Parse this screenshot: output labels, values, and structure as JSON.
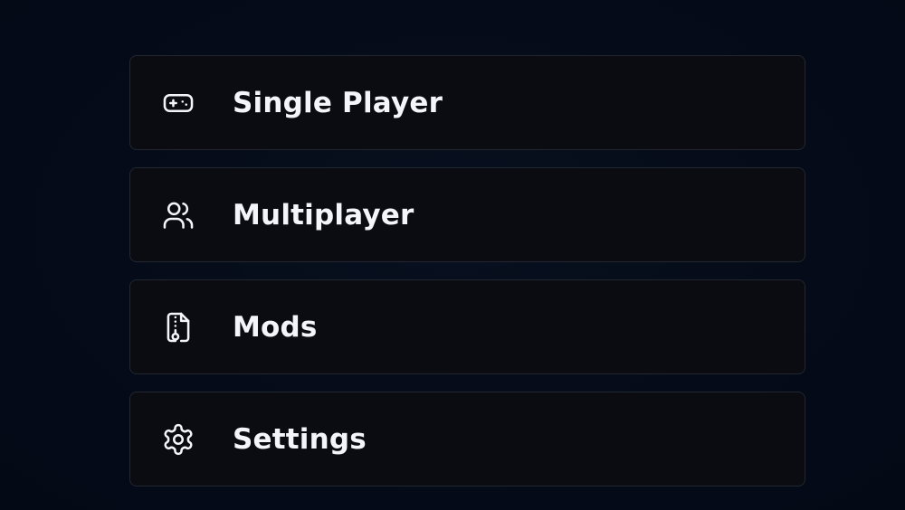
{
  "menu": {
    "items": [
      {
        "label": "Single Player",
        "icon": "gamepad-icon"
      },
      {
        "label": "Multiplayer",
        "icon": "users-icon"
      },
      {
        "label": "Mods",
        "icon": "file-archive-icon"
      },
      {
        "label": "Settings",
        "icon": "gear-icon"
      }
    ]
  },
  "colors": {
    "background": "#060c1a",
    "button_bg": "#0a0c12",
    "button_border": "#222731",
    "text": "#f4f5f8"
  }
}
